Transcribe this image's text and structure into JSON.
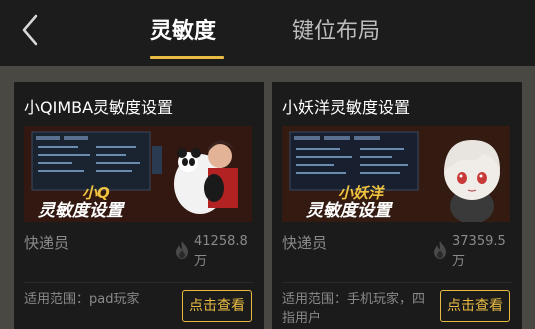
{
  "header": {
    "back_label": "",
    "tabs": [
      {
        "label": "灵敏度",
        "active": true
      },
      {
        "label": "键位布局",
        "active": false
      }
    ]
  },
  "colors": {
    "accent": "#e8bb43",
    "header_bg": "#1c1c1c",
    "page_bg": "#4a4842",
    "card_bg": "#1b1b1b",
    "muted_text": "#8a8a8a"
  },
  "cards": [
    {
      "title": "小QIMBA灵敏度设置",
      "thumb_caption_top": "小Q",
      "thumb_caption_bottom": "灵敏度设置",
      "author": "快递员",
      "views": "41258.8万",
      "scope": "适用范围：pad玩家",
      "button": "点击查看",
      "icon": "flame-icon"
    },
    {
      "title": "小妖洋灵敏度设置",
      "thumb_caption_top": "小妖洋",
      "thumb_caption_bottom": "灵敏度设置",
      "author": "快递员",
      "views": "37359.5万",
      "scope": "适用范围：手机玩家，四指用户",
      "button": "点击查看",
      "icon": "flame-icon"
    }
  ]
}
